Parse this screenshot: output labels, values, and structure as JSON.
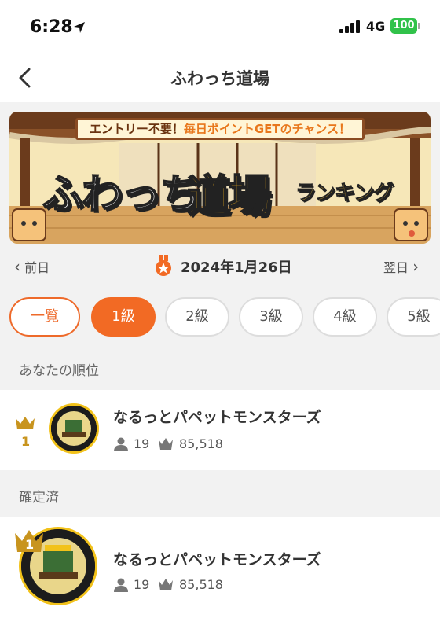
{
  "status": {
    "time": "6:28",
    "network": "4G",
    "battery": "100"
  },
  "nav": {
    "title": "ふわっち道場"
  },
  "banner": {
    "top_plain": "エントリー不要！",
    "top_highlight": "毎日ポイントGETのチャンス！",
    "title_main": "ふわっち",
    "title_accent": "道場",
    "subtitle": "ランキング"
  },
  "date_nav": {
    "prev": "前日",
    "date": "2024年1月26日",
    "next": "翌日"
  },
  "tabs": [
    "一覧",
    "1級",
    "2級",
    "3級",
    "4級",
    "5級"
  ],
  "my_rank": {
    "section_label": "あなたの順位",
    "rank": "1",
    "name": "なるっとパペットモンスターズ",
    "members": "19",
    "points": "85,518",
    "avatar_text": "RADIOTALK SHOW"
  },
  "confirmed": {
    "section_label": "確定済",
    "rank": "1",
    "name": "なるっとパペットモンスターズ",
    "members": "19",
    "points": "85,518",
    "avatar_text": "RADIOTALK SHOW"
  },
  "colors": {
    "accent": "#f26a24",
    "gold": "#c8941e",
    "battery": "#31c24a"
  }
}
